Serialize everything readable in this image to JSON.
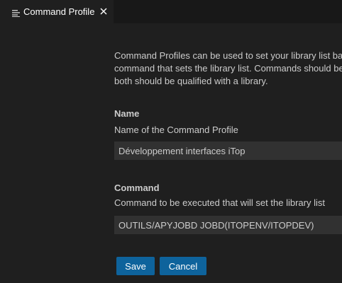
{
  "tab": {
    "label": "Command Profile",
    "icon": "lines-icon",
    "close_icon": "close-icon"
  },
  "intro": {
    "line1": "Command Profiles can be used to set your library list ba",
    "line2": "command that sets the library list. Commands should be",
    "line3": "both should be qualified with a library."
  },
  "fields": {
    "name": {
      "title": "Name",
      "description": "Name of the Command Profile",
      "value": "Développement interfaces iTop"
    },
    "command": {
      "title": "Command",
      "description": "Command to be executed that will set the library list",
      "value": "OUTILS/APYJOBD JOBD(ITOPENV/ITOPDEV)"
    }
  },
  "buttons": {
    "save_label": "Save",
    "cancel_label": "Cancel"
  },
  "colors": {
    "background": "#1f1f1f",
    "tabbar": "#181818",
    "input_background": "#313131",
    "button": "#0e639c",
    "text": "#cccccc"
  }
}
